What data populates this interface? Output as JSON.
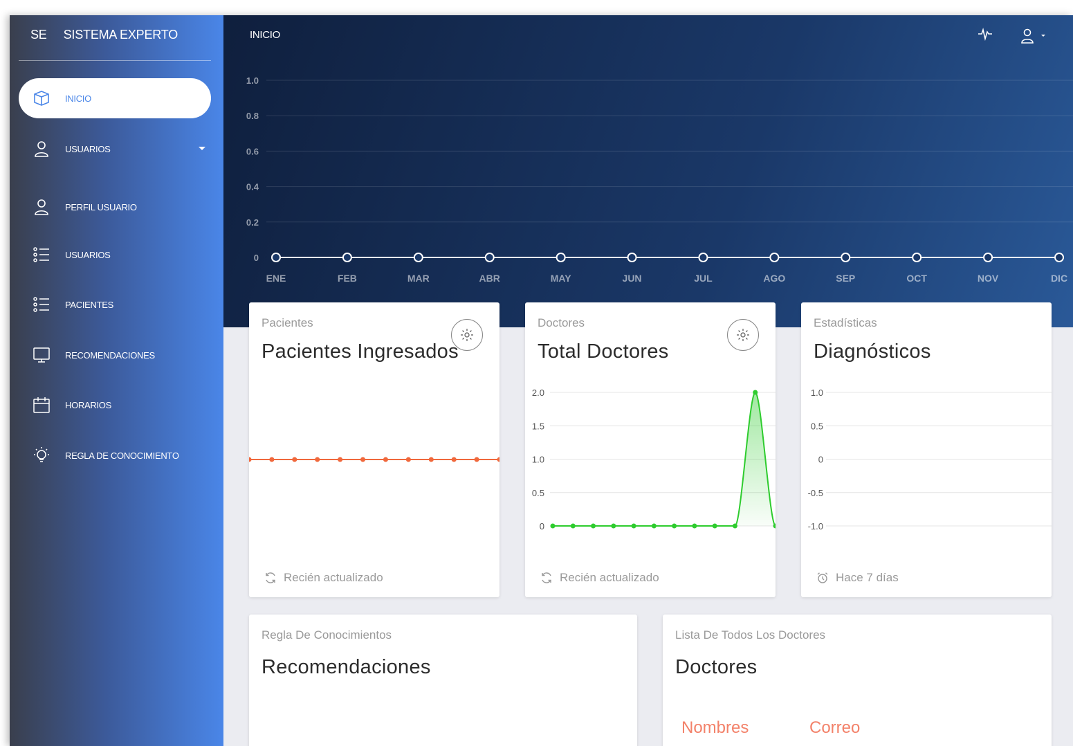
{
  "brand": {
    "short": "SE",
    "name": "SISTEMA EXPERTO"
  },
  "header": {
    "title": "INICIO"
  },
  "sidebar": {
    "items": [
      {
        "label": "INICIO",
        "icon": "cube-icon",
        "active": true
      },
      {
        "label": "USUARIOS",
        "icon": "user-icon",
        "has_caret": true
      },
      {
        "label": "PERFIL USUARIO",
        "icon": "user-icon"
      },
      {
        "label": "USUARIOS",
        "icon": "list-icon"
      },
      {
        "label": "PACIENTES",
        "icon": "list-icon"
      },
      {
        "label": "RECOMENDACIONES",
        "icon": "monitor-icon"
      },
      {
        "label": "HORARIOS",
        "icon": "calendar-icon"
      },
      {
        "label": "REGLA DE CONOCIMIENTO",
        "icon": "bulb-icon"
      }
    ]
  },
  "chart_data": [
    {
      "type": "line",
      "categories": [
        "ENE",
        "FEB",
        "MAR",
        "ABR",
        "MAY",
        "JUN",
        "JUL",
        "AGO",
        "SEP",
        "OCT",
        "NOV",
        "DIC"
      ],
      "values": [
        0,
        0,
        0,
        0,
        0,
        0,
        0,
        0,
        0,
        0,
        0,
        0
      ],
      "yticks": [
        "1.0",
        "0.8",
        "0.6",
        "0.4",
        "0.2",
        "0"
      ],
      "ylim": [
        0,
        1
      ],
      "grid": true,
      "color": "#ffffff"
    },
    {
      "type": "line",
      "values": [
        1,
        1,
        1,
        1,
        1,
        1,
        1,
        1,
        1,
        1,
        1,
        1
      ],
      "color": "#f0683c"
    },
    {
      "type": "area",
      "values": [
        0,
        0,
        0,
        0,
        0,
        0,
        0,
        0,
        0,
        0,
        2,
        0
      ],
      "yticks": [
        "2.0",
        "1.5",
        "1.0",
        "0.5",
        "0"
      ],
      "ylim": [
        0,
        2
      ],
      "grid": true,
      "color": "#2ecc2e"
    },
    {
      "type": "line",
      "values": [],
      "yticks": [
        "1.0",
        "0.5",
        "0",
        "-0.5",
        "-1.0"
      ],
      "ylim": [
        -1,
        1
      ],
      "grid": true
    }
  ],
  "cards": {
    "pacientes": {
      "category": "Pacientes",
      "title": "Pacientes Ingresados",
      "footer": "Recién actualizado"
    },
    "doctores": {
      "category": "Doctores",
      "title": "Total Doctores",
      "footer": "Recién actualizado"
    },
    "estadisticas": {
      "category": "Estadísticas",
      "title": "Diagnósticos",
      "footer": "Hace 7 días"
    },
    "regla": {
      "category": "Regla De Conocimientos",
      "title": "Recomendaciones"
    },
    "lista": {
      "category": "Lista De Todos Los Doctores",
      "title": "Doctores",
      "columns": [
        "Nombres",
        "Correo"
      ]
    }
  },
  "colors": {
    "accent": "#4a86e8",
    "header_dark": "#0f1f3d",
    "orange": "#f0683c",
    "green": "#2ecc2e",
    "column_head": "#f3826a"
  }
}
